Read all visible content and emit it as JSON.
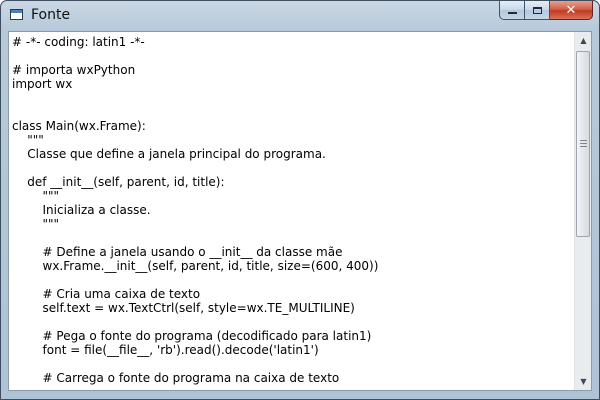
{
  "window": {
    "title": "Fonte",
    "buttons": {
      "minimize_icon": "minimize-icon",
      "maximize_icon": "maximize-icon",
      "close_icon": "close-icon",
      "close_glyph": "✕"
    }
  },
  "editor": {
    "lines": [
      "# -*- coding: latin1 -*-",
      "",
      "# importa wxPython",
      "import wx",
      "",
      "",
      "class Main(wx.Frame):",
      "    \"\"\"",
      "    Classe que define a janela principal do programa.",
      "",
      "    def __init__(self, parent, id, title):",
      "        \"\"\"",
      "        Inicializa a classe.",
      "        \"\"\"",
      "",
      "        # Define a janela usando o __init__ da classe mãe",
      "        wx.Frame.__init__(self, parent, id, title, size=(600, 400))",
      "",
      "        # Cria uma caixa de texto",
      "        self.text = wx.TextCtrl(self, style=wx.TE_MULTILINE)",
      "",
      "        # Pega o fonte do programa (decodificado para latin1)",
      "        font = file(__file__, 'rb').read().decode('latin1')",
      "",
      "        # Carrega o fonte do programa na caixa de texto"
    ]
  },
  "scrollbar": {
    "position": 0.0,
    "visible_fraction": 0.55,
    "up_glyph": "▲",
    "down_glyph": "▼"
  },
  "colors": {
    "titlebar": "#b6c9da",
    "close_button": "#c23a22"
  }
}
